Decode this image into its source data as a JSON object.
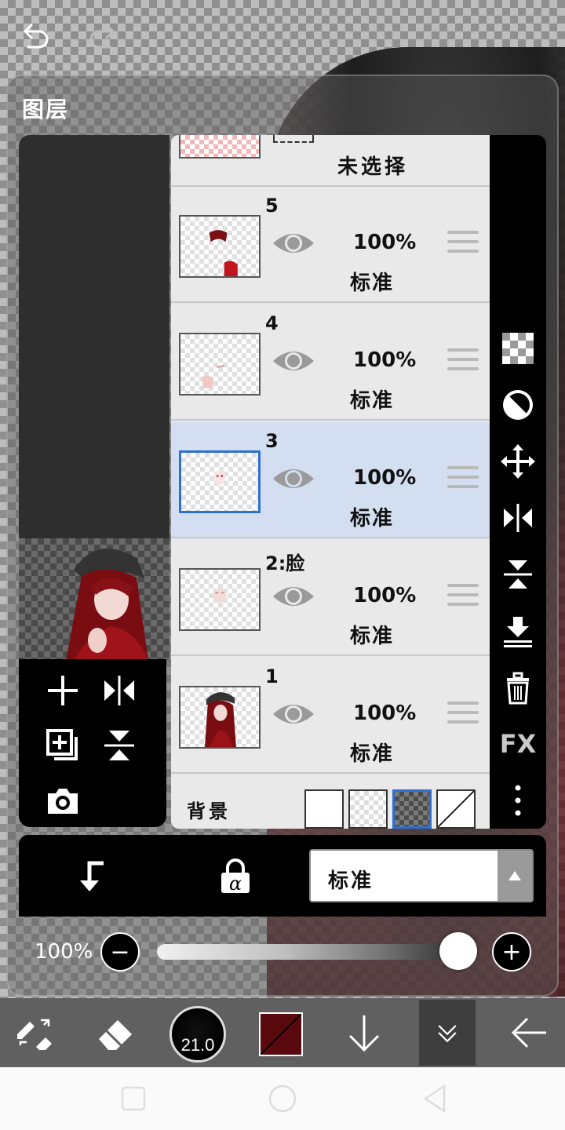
{
  "panel": {
    "title": "图层"
  },
  "layers_header": {
    "label": "未选择"
  },
  "layers": [
    {
      "name": "5",
      "opacity": "100%",
      "mode": "标准",
      "selected": false
    },
    {
      "name": "4",
      "opacity": "100%",
      "mode": "标准",
      "selected": false
    },
    {
      "name": "3",
      "opacity": "100%",
      "mode": "标准",
      "selected": true
    },
    {
      "name": "2:脸",
      "opacity": "100%",
      "mode": "标准",
      "selected": false
    },
    {
      "name": "1",
      "opacity": "100%",
      "mode": "标准",
      "selected": false
    }
  ],
  "background": {
    "label": "背景",
    "swatches": [
      "white",
      "checker-light",
      "checker-dark",
      "transparent-slash"
    ],
    "selected_index": 2
  },
  "right_tools": {
    "fx_label": "FX",
    "icons": [
      "checker-icon",
      "half-circle-icon",
      "move-icon",
      "flip-horizontal-icon",
      "flip-vertical-icon",
      "merge-down-icon",
      "trash-icon",
      "fx-icon",
      "more-icon"
    ]
  },
  "blend": {
    "selected": "标准"
  },
  "opacity": {
    "label": "100%",
    "value": 1.0
  },
  "toolbar": {
    "brush_size": "21.0",
    "color": "#5a0a0f"
  },
  "colors": {
    "selected_border": "#2f6fd0",
    "selected_row": "#d3dff0"
  }
}
